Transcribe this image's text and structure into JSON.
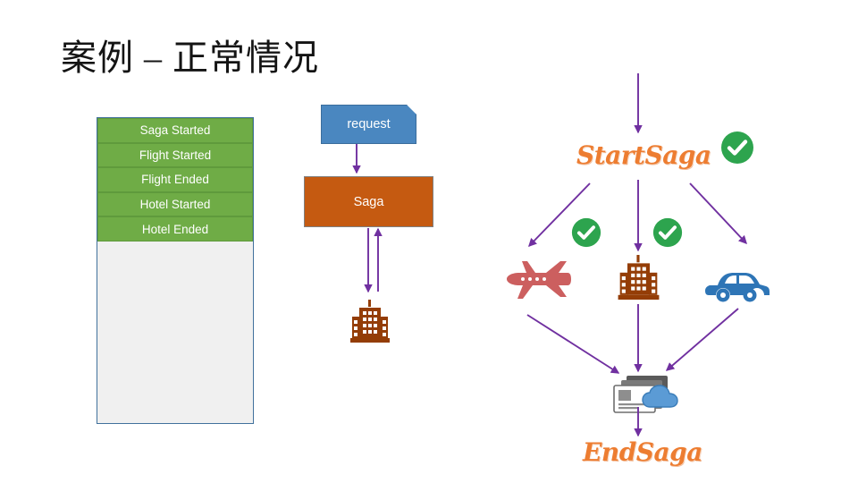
{
  "slide": {
    "title": "案例 – 正常情况"
  },
  "event_log": {
    "panel_name": "event-log",
    "items": [
      {
        "label": "Saga Started"
      },
      {
        "label": "Flight Started"
      },
      {
        "label": "Flight Ended"
      },
      {
        "label": "Hotel Started"
      },
      {
        "label": "Hotel Ended"
      }
    ]
  },
  "middle_flow": {
    "request_label": "request",
    "saga_label": "Saga",
    "hotel_icon": "hotel-building-icon"
  },
  "saga_flow": {
    "start_label": "StartSaga",
    "end_label": "EndSaga",
    "services": [
      {
        "icon": "airplane-icon",
        "name": "flight-service"
      },
      {
        "icon": "hotel-building-icon",
        "name": "hotel-service"
      },
      {
        "icon": "car-icon",
        "name": "car-service"
      }
    ],
    "end_icon": "photo-card-cloud-icon",
    "status_checks": [
      {
        "icon": "check-circle-icon",
        "name": "startsaga-status"
      },
      {
        "icon": "check-circle-icon",
        "name": "flight-status"
      },
      {
        "icon": "check-circle-icon",
        "name": "hotel-status"
      }
    ]
  },
  "colors": {
    "green_item": "#6FAC46",
    "panel_border": "#41719C",
    "panel_fill": "#f0f0f0",
    "request_blue": "#4A87C0",
    "saga_orange": "#C55A11",
    "arrow_purple": "#7030A0",
    "script_orange": "#ED7D31",
    "check_green": "#2DA44E",
    "plane_red": "#CC5F5F",
    "car_blue": "#2E75B6",
    "hotel_brown": "#943D06",
    "cloud_blue": "#5B9BD5"
  }
}
